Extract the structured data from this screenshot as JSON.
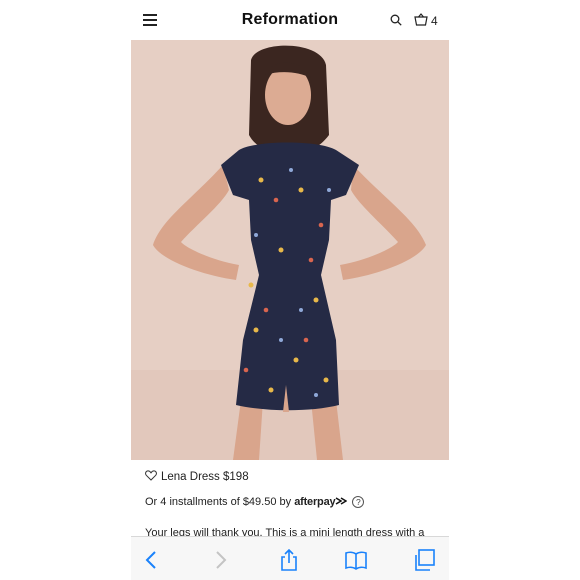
{
  "header": {
    "logo": "Reformation",
    "cart_count": "4",
    "icons": [
      "hamburger-menu-icon",
      "search-icon",
      "shopping-bag-icon"
    ]
  },
  "product": {
    "name_price": "Lena Dress $198",
    "installments_text": "Or 4 installments of $49.50 by",
    "afterpay_brand": "afterpay",
    "help_glyph": "?",
    "description": "Your legs will thank you. This is a mini length dress with a"
  },
  "toolbar": {
    "icons": [
      "back-icon",
      "forward-icon",
      "share-icon",
      "bookmarks-icon",
      "tabs-icon"
    ]
  },
  "colors": {
    "accent_blue": "#1a82fb",
    "photo_background": "#e6cfc4",
    "dress_navy": "#252a45"
  }
}
